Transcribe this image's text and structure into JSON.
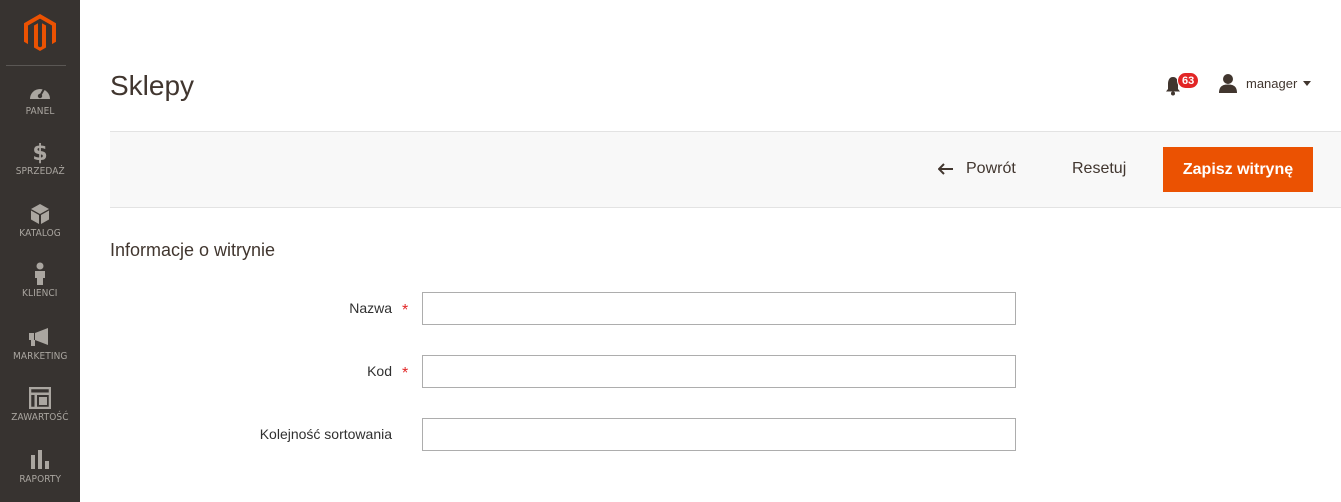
{
  "sidebar": {
    "logo": "magento-logo",
    "items": [
      {
        "label": "PANEL",
        "icon": "dashboard-gauge-icon"
      },
      {
        "label": "SPRZEDAŻ",
        "icon": "dollar-icon"
      },
      {
        "label": "KATALOG",
        "icon": "box-icon"
      },
      {
        "label": "KLIENCI",
        "icon": "person-icon"
      },
      {
        "label": "MARKETING",
        "icon": "megaphone-icon"
      },
      {
        "label": "ZAWARTOŚĆ",
        "icon": "layout-icon"
      },
      {
        "label": "RAPORTY",
        "icon": "bar-chart-icon"
      }
    ]
  },
  "header": {
    "title": "Sklepy",
    "notifications_count": "63",
    "user_name": "manager"
  },
  "actions": {
    "back_label": "Powrót",
    "reset_label": "Resetuj",
    "save_label": "Zapisz witrynę"
  },
  "form": {
    "section_title": "Informacje o witrynie",
    "fields": [
      {
        "label": "Nazwa",
        "required": true,
        "value": ""
      },
      {
        "label": "Kod",
        "required": true,
        "value": ""
      },
      {
        "label": "Kolejność sortowania",
        "required": false,
        "value": ""
      }
    ]
  },
  "colors": {
    "sidebar_bg": "#373330",
    "accent": "#eb5202",
    "badge": "#e22626"
  }
}
